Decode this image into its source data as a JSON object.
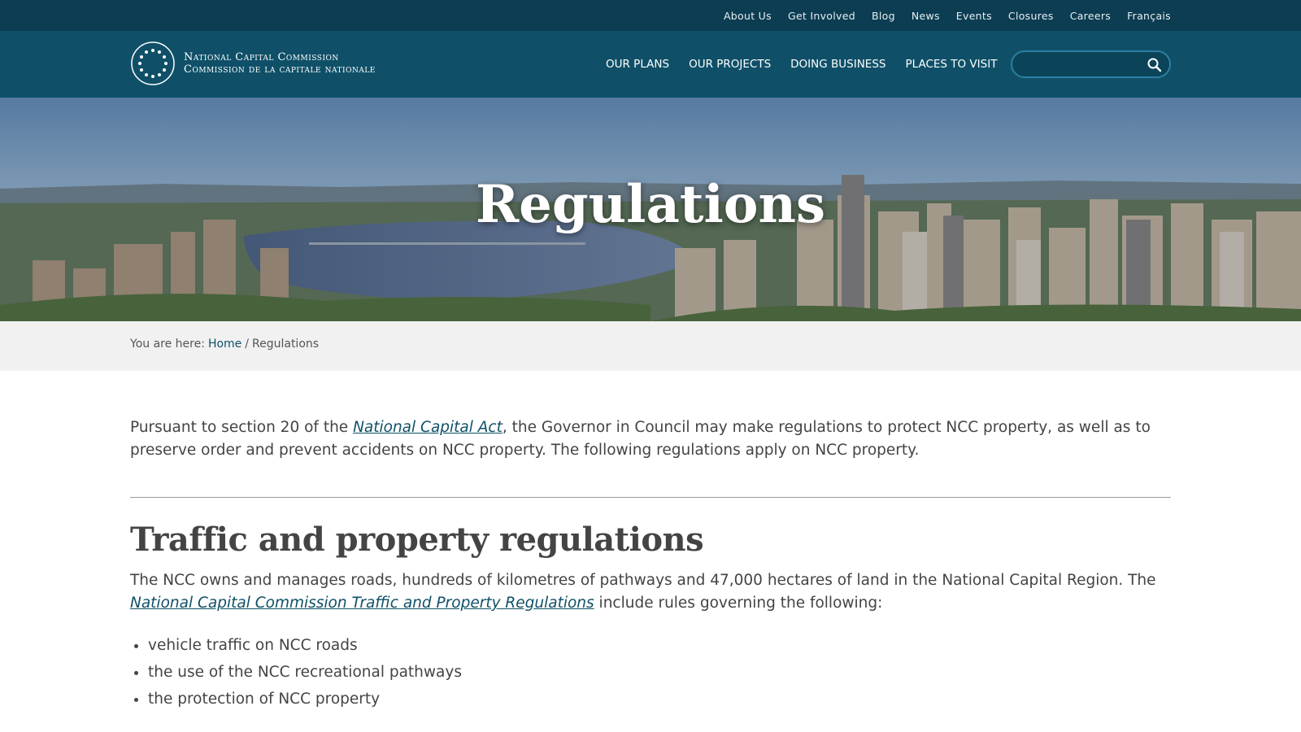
{
  "utility_nav": [
    "About Us",
    "Get Involved",
    "Blog",
    "News",
    "Events",
    "Closures",
    "Careers",
    "Français"
  ],
  "logo": {
    "line1": "National Capital Commission",
    "line2": "Commission de la capitale nationale"
  },
  "main_nav": [
    "OUR PLANS",
    "OUR PROJECTS",
    "DOING BUSINESS",
    "PLACES TO VISIT"
  ],
  "search": {
    "placeholder": ""
  },
  "hero": {
    "title": "Regulations"
  },
  "breadcrumb": {
    "prefix": "You are here:",
    "home": "Home",
    "separator": "/",
    "current": "Regulations"
  },
  "intro": {
    "before": "Pursuant to section 20 of the ",
    "link": "National Capital Act",
    "after": ", the Governor in Council may make regulations to protect NCC property, as well as to preserve order and prevent accidents on NCC property. The following regulations apply on NCC property."
  },
  "section": {
    "title": "Traffic and property regulations",
    "before": "The NCC owns and manages roads, hundreds of kilometres of pathways and 47,000 hectares of land in the National Capital Region. The ",
    "link": "National Capital Commission Traffic and Property Regulations",
    "after": " include rules governing the following:",
    "items": [
      "vehicle traffic on NCC roads",
      "the use of the NCC recreational pathways",
      "the protection of NCC property"
    ]
  },
  "colors": {
    "utility_bg": "#0c3d52",
    "header_bg": "#0f5068",
    "breadcrumb_bg": "#f1f1f1",
    "link": "#0f5068",
    "text": "#444444"
  },
  "icons": {
    "search": "search-icon",
    "logo": "ncc-logo-icon"
  }
}
